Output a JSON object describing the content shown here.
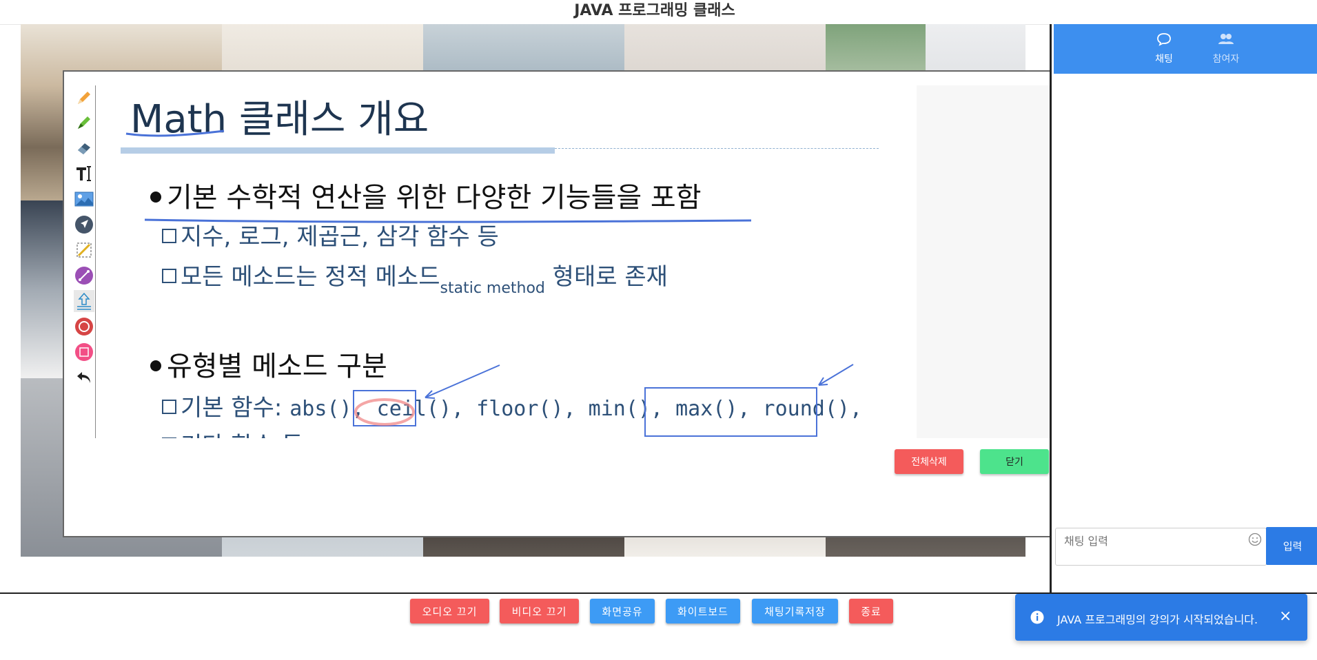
{
  "app": {
    "title": "JAVA 프로그래밍 클래스"
  },
  "whiteboard": {
    "tools": [
      "pencil-icon",
      "highlighter-icon",
      "eraser-icon",
      "text-tool-icon",
      "image-icon",
      "pointer-icon",
      "crop-icon",
      "line-tool-icon",
      "upload-icon",
      "circle-tool-icon",
      "rectangle-tool-icon",
      "undo-icon"
    ],
    "slide": {
      "title": "Math 클래스 개요",
      "bullet1": "기본 수학적 연산을 위한 다양한 기능들을 포함",
      "sub1": "지수, 로그, 제곱근, 삼각 함수 등",
      "sub2_main": "모든 메소드는 정적 메소드",
      "sub2_small": "static method",
      "sub2_tail": " 형태로 존재",
      "bullet2": "유형별 메소드 구분",
      "sub3_label": "기본 함수: ",
      "sub3_code": "abs(), ceil(), floor(), min(), max(), round(),",
      "sub4_partial": "기타 함수 등"
    },
    "clear_all_label": "전체삭제",
    "close_label": "닫기"
  },
  "chat": {
    "tab_chat": "채팅",
    "tab_participants": "참여자",
    "input_placeholder": "채팅 입력",
    "send_label": "입력"
  },
  "controls": {
    "audio_off": "오디오 끄기",
    "video_off": "비디오 끄기",
    "screen_share": "화면공유",
    "whiteboard": "화이트보드",
    "save_chat": "채팅기록저장",
    "end": "종료"
  },
  "toast": {
    "message": "JAVA 프로그래밍의 강의가 시작되었습니다.",
    "close": "×"
  },
  "colors": {
    "accent_blue": "#2c7be5",
    "danger_red": "#f45b5b",
    "success_green": "#4de38c"
  }
}
